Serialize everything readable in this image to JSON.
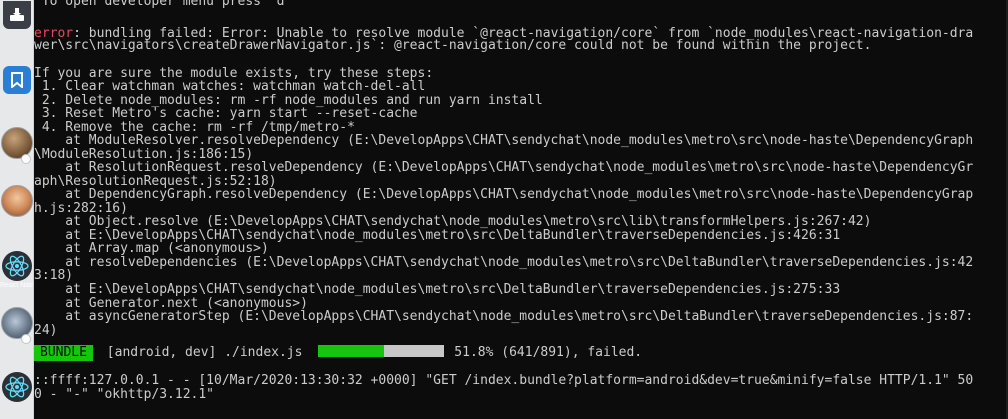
{
  "dock": {
    "items": [
      {
        "name": "download-app-icon",
        "glyph": "▼",
        "color": "#3a3f47"
      },
      {
        "name": "bookmark-app-icon",
        "glyph": "▮",
        "color": "#2a7fd4"
      },
      {
        "name": "avatar-app-1"
      },
      {
        "name": "avatar-app-2"
      },
      {
        "name": "react-native-app-1"
      },
      {
        "name": "react-native-app-2"
      },
      {
        "name": "avatar-app-3"
      },
      {
        "name": "react-native-app-3"
      }
    ],
    "react_label": "React Native",
    "react_color": "#61dafb"
  },
  "terminal": {
    "header_text": " To open developer menu press \"d\"",
    "error_prefix": "error",
    "error_line_1": ": bundling failed: Error: Unable to resolve module `@react-navigation/core` from `node_modules\\react-navigation-dra",
    "error_line_2": "wer\\src\\navigators\\createDrawerNavigator.js`: @react-navigation/core could not be found within the project.",
    "steps_intro": "If you are sure the module exists, try these steps:",
    "steps": [
      " 1. Clear watchman watches: watchman watch-del-all",
      " 2. Delete node_modules: rm -rf node_modules and run yarn install",
      " 3. Reset Metro's cache: yarn start --reset-cache",
      " 4. Remove the cache: rm -rf /tmp/metro-*"
    ],
    "stack": [
      "    at ModuleResolver.resolveDependency (E:\\DevelopApps\\CHAT\\sendychat\\node_modules\\metro\\src\\node-haste\\DependencyGraph",
      "\\ModuleResolution.js:186:15)",
      "    at ResolutionRequest.resolveDependency (E:\\DevelopApps\\CHAT\\sendychat\\node_modules\\metro\\src\\node-haste\\DependencyGr",
      "aph\\ResolutionRequest.js:52:18)",
      "    at DependencyGraph.resolveDependency (E:\\DevelopApps\\CHAT\\sendychat\\node_modules\\metro\\src\\node-haste\\DependencyGrap",
      "h.js:282:16)",
      "    at Object.resolve (E:\\DevelopApps\\CHAT\\sendychat\\node_modules\\metro\\src\\lib\\transformHelpers.js:267:42)",
      "    at E:\\DevelopApps\\CHAT\\sendychat\\node_modules\\metro\\src\\DeltaBundler\\traverseDependencies.js:426:31",
      "    at Array.map (<anonymous>)",
      "    at resolveDependencies (E:\\DevelopApps\\CHAT\\sendychat\\node_modules\\metro\\src\\DeltaBundler\\traverseDependencies.js:42",
      "3:18)",
      "    at E:\\DevelopApps\\CHAT\\sendychat\\node_modules\\metro\\src\\DeltaBundler\\traverseDependencies.js:275:33",
      "    at Generator.next (<anonymous>)",
      "    at asyncGeneratorStep (E:\\DevelopApps\\CHAT\\sendychat\\node_modules\\metro\\src\\DeltaBundler\\traverseDependencies.js:87:",
      "24)"
    ],
    "bundle": {
      "badge": "BUNDLE",
      "target": " [android, dev] ./index.js ",
      "progress": 0.518,
      "status": "51.8% (641/891), failed."
    },
    "request_line_1": "::ffff:127.0.0.1 - - [10/Mar/2020:13:30:32 +0000] \"GET /index.bundle?platform=android&dev=true&minify=false HTTP/1.1\" 50",
    "request_line_2": "0 - \"-\" \"okhttp/3.12.1\""
  },
  "colors": {
    "background": "#0c0c0c",
    "text": "#cccccc",
    "error": "#e74856",
    "success": "#16c60c"
  }
}
